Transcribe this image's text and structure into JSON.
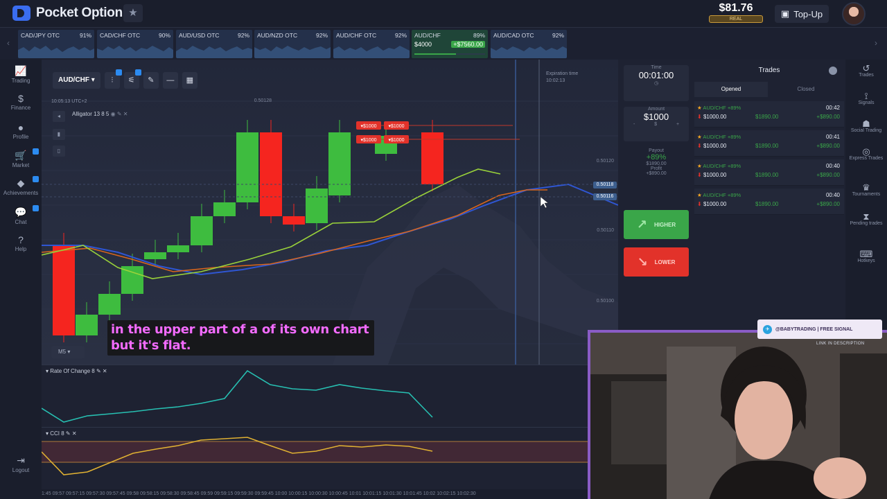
{
  "app": {
    "logo": "Pocket Option",
    "fav_icon": "star-icon"
  },
  "account": {
    "balance": "$81.76",
    "type": "REAL",
    "topup_label": "Top-Up"
  },
  "asset_strip": [
    {
      "name": "CAD/JPY OTC",
      "pct": "91%"
    },
    {
      "name": "CAD/CHF OTC",
      "pct": "90%"
    },
    {
      "name": "AUD/USD OTC",
      "pct": "92%"
    },
    {
      "name": "AUD/NZD OTC",
      "pct": "92%"
    },
    {
      "name": "AUD/CHF OTC",
      "pct": "92%"
    },
    {
      "name": "AUD/CHF",
      "pct": "89%",
      "price": "$4000",
      "profit": "+$7560.00"
    },
    {
      "name": "AUD/CAD OTC",
      "pct": "92%"
    }
  ],
  "leftnav": [
    {
      "label": "Trading",
      "icon": "chart-icon"
    },
    {
      "label": "Finance",
      "icon": "dollar-icon"
    },
    {
      "label": "Profile",
      "icon": "user-icon"
    },
    {
      "label": "Market",
      "icon": "cart-icon"
    },
    {
      "label": "Achievements",
      "icon": "diamond-icon"
    },
    {
      "label": "Chat",
      "icon": "chat-icon"
    },
    {
      "label": "Help",
      "icon": "help-icon"
    },
    {
      "label": "Logout",
      "icon": "logout-icon"
    }
  ],
  "chart": {
    "asset": "AUD/CHF",
    "time": "10:05:13   UTC+2",
    "indicator": "Alligator 13 8 5",
    "timeframe": "M5",
    "expiration_label": "Expiration time",
    "expiration_time": "10:02:13",
    "price_top": "0.50128",
    "prices": [
      "0.50120",
      "0.50118",
      "0.50116",
      "0.50110",
      "0.50100"
    ],
    "trade_tags": [
      "$1000",
      "$1000",
      "$1000",
      "$1000"
    ],
    "colors": {
      "bull": "#3ebc3f",
      "bear": "#f5251f",
      "jaw": "#2f56d3",
      "teeth": "#d9661c",
      "lips": "#9ad23a"
    }
  },
  "chart_data": {
    "type": "candlestick",
    "series": [
      {
        "name": "Alligator 13 8 5",
        "kind": "ohlc"
      }
    ]
  },
  "caption": {
    "line1": "in the upper part of a of its own chart",
    "line2": "but it's flat."
  },
  "indicators": [
    {
      "label": "Rate Of Change 8"
    },
    {
      "label": "CCI 8"
    }
  ],
  "time_axis": "1:45    09:57    09:57:15 09:57:30 09:57:45    09:58    09:58:15 09:58:30 09:58:45    09:59    09:59:15 09:59:30 09:59:45    10:00    10:00:15 10:00:30 10:00:45    10:01    10:01:15 10:01:30 10:01:45    10:02    10:02:15 10:02:30",
  "trade_panel": {
    "time_label": "Time",
    "time_value": "00:01:00",
    "amount_label": "Amount",
    "amount_value": "$1000",
    "minus": "-",
    "currency": "$",
    "plus": "+",
    "payout_label": "Payout",
    "payout_pct": "+89%",
    "payout_value": "$1890.00",
    "profit_label": "Profit",
    "profit_value": "+$890.00",
    "higher": "HIGHER",
    "lower": "LOWER"
  },
  "trades": {
    "title": "Trades",
    "tab_opened": "Opened",
    "tab_closed": "Closed",
    "rows": [
      {
        "asset": "AUD/CHF +89%",
        "amount": "$1000.00",
        "payout": "$1890.00",
        "time": "00:42",
        "profit": "+$890.00"
      },
      {
        "asset": "AUD/CHF +89%",
        "amount": "$1000.00",
        "payout": "$1890.00",
        "time": "00:41",
        "profit": "+$890.00"
      },
      {
        "asset": "AUD/CHF +89%",
        "amount": "$1000.00",
        "payout": "$1890.00",
        "time": "00:40",
        "profit": "+$890.00"
      },
      {
        "asset": "AUD/CHF +89%",
        "amount": "$1000.00",
        "payout": "$1890.00",
        "time": "00:40",
        "profit": "+$890.00"
      }
    ]
  },
  "rightnav": [
    {
      "label": "Trades",
      "icon": "history-icon"
    },
    {
      "label": "Signals",
      "icon": "antenna-icon"
    },
    {
      "label": "Social Trading",
      "icon": "people-icon"
    },
    {
      "label": "Express Trades",
      "icon": "express-icon"
    },
    {
      "label": "Tournaments",
      "icon": "trophy-icon"
    },
    {
      "label": "Pending trades",
      "icon": "hourglass-icon"
    },
    {
      "label": "Hotkeys",
      "icon": "keyboard-icon"
    }
  ],
  "webcam": {
    "banner": "@BABYTRADING | FREE SIGNAL",
    "sub": "LINK IN DESCRIPTION"
  }
}
